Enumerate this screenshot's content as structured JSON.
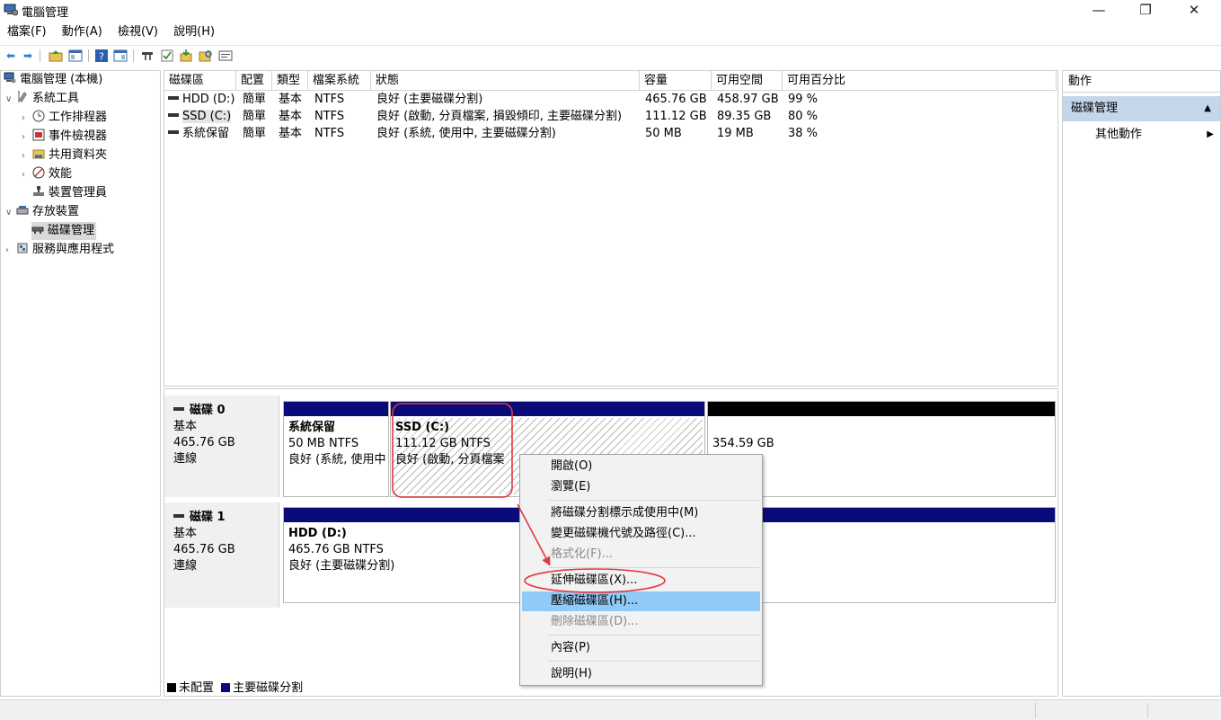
{
  "window": {
    "title": "電腦管理",
    "controls": {
      "minimize": "—",
      "restore": "❐",
      "close": "✕"
    }
  },
  "menubar": [
    "檔案(F)",
    "動作(A)",
    "檢視(V)",
    "說明(H)"
  ],
  "tree": {
    "root": "電腦管理 (本機)",
    "system_tools": "系統工具",
    "task_scheduler": "工作排程器",
    "event_viewer": "事件檢視器",
    "shared_folders": "共用資料夾",
    "performance": "效能",
    "device_manager": "裝置管理員",
    "storage": "存放裝置",
    "disk_management": "磁碟管理",
    "services_apps": "服務與應用程式"
  },
  "volumes": {
    "headers": [
      "磁碟區",
      "配置",
      "類型",
      "檔案系統",
      "狀態",
      "容量",
      "可用空間",
      "可用百分比"
    ],
    "rows": [
      [
        "HDD (D:)",
        "簡單",
        "基本",
        "NTFS",
        "良好 (主要磁碟分割)",
        "465.76 GB",
        "458.97 GB",
        "99 %"
      ],
      [
        "SSD (C:)",
        "簡單",
        "基本",
        "NTFS",
        "良好 (啟動, 分頁檔案, 損毀傾印, 主要磁碟分割)",
        "111.12 GB",
        "89.35 GB",
        "80 %"
      ],
      [
        "系統保留",
        "簡單",
        "基本",
        "NTFS",
        "良好 (系統, 使用中, 主要磁碟分割)",
        "50 MB",
        "19 MB",
        "38 %"
      ]
    ]
  },
  "disks": {
    "disk0": {
      "name": "磁碟 0",
      "type": "基本",
      "size": "465.76 GB",
      "status": "連線",
      "p_sys": {
        "name": "系統保留",
        "size": "50 MB NTFS",
        "status": "良好 (系統, 使用中"
      },
      "p_ssd": {
        "name": "SSD  (C:)",
        "size": "111.12 GB NTFS",
        "status": "良好 (啟動, 分頁檔案"
      },
      "p_unalloc": {
        "size": "354.59 GB"
      }
    },
    "disk1": {
      "name": "磁碟 1",
      "type": "基本",
      "size": "465.76 GB",
      "status": "連線",
      "p_hdd": {
        "name": "HDD  (D:)",
        "size": "465.76 GB NTFS",
        "status": "良好 (主要磁碟分割)"
      }
    }
  },
  "legend": {
    "unallocated": "未配置",
    "primary": "主要磁碟分割"
  },
  "colors": {
    "unallocated": "#000000",
    "primary": "#0a0a78",
    "selected_action": "#c4d6ea",
    "menu_highlight": "#91c9f7",
    "annotation": "#e0393e"
  },
  "actions": {
    "header": "動作",
    "section": "磁碟管理",
    "more": "其他動作"
  },
  "context_menu": {
    "open": "開啟(O)",
    "explore": "瀏覽(E)",
    "mark_active": "將磁碟分割標示成使用中(M)",
    "change_letter": "變更磁碟機代號及路徑(C)...",
    "format": "格式化(F)...",
    "extend": "延伸磁碟區(X)...",
    "shrink": "壓縮磁碟區(H)...",
    "delete": "刪除磁碟區(D)...",
    "properties": "內容(P)",
    "help": "說明(H)"
  }
}
